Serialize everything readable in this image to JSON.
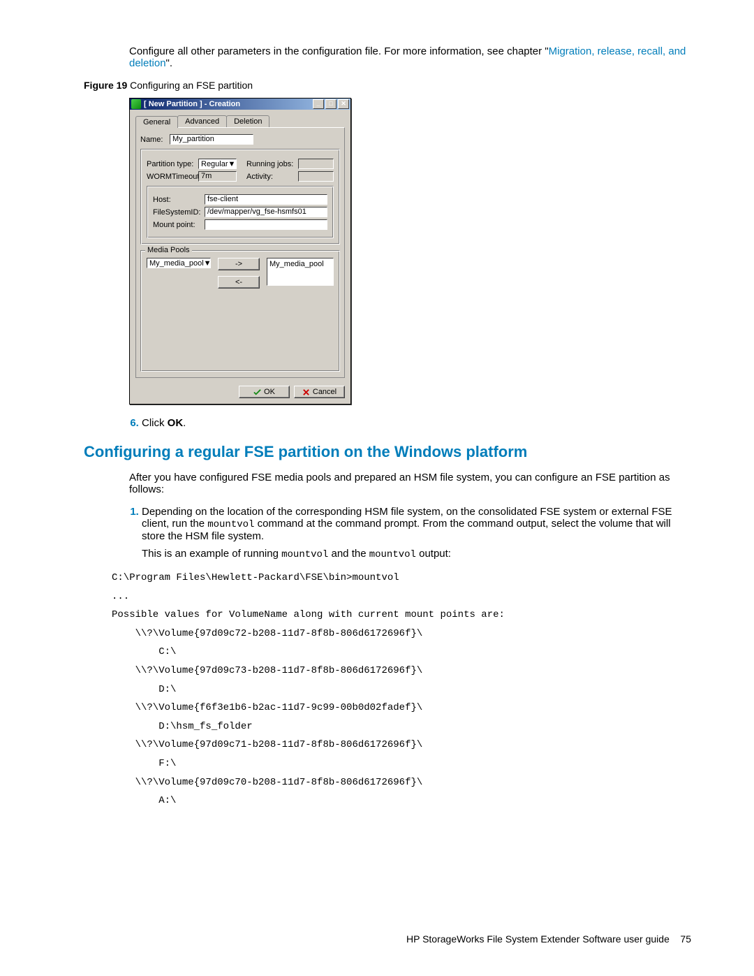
{
  "intro_paragraph": {
    "text_before_link": "Configure all other parameters in the configuration file. For more information, see chapter \"",
    "link_text": "Migration, release, recall, and deletion",
    "text_after_link": "\"."
  },
  "figure": {
    "label": "Figure 19",
    "caption": " Configuring an FSE partition"
  },
  "dialog": {
    "title": "[ New Partition ] - Creation",
    "tabs": {
      "general": "General",
      "advanced": "Advanced",
      "deletion": "Deletion"
    },
    "name_label": "Name:",
    "name_value": "My_partition",
    "partition_type_label": "Partition type:",
    "partition_type_value": "Regular",
    "running_jobs_label": "Running jobs:",
    "running_jobs_value": "",
    "worm_timeout_label": "WORMTimeout:",
    "worm_timeout_value": "7m",
    "activity_label": "Activity:",
    "activity_value": "",
    "host_label": "Host:",
    "host_value": "fse-client",
    "filesystemid_label": "FileSystemID:",
    "filesystemid_value": "/dev/mapper/vg_fse-hsmfs01",
    "mount_point_label": "Mount point:",
    "mount_point_value": "",
    "media_pools_title": "Media Pools",
    "source_pool": "My_media_pool",
    "target_pool": "My_media_pool",
    "add_btn": "->",
    "remove_btn": "<-",
    "ok": "OK",
    "cancel": "Cancel"
  },
  "step6": {
    "num": "6.",
    "text_prefix": "Click ",
    "bold": "OK",
    "text_suffix": "."
  },
  "heading2": "Configuring a regular FSE partition on the Windows platform",
  "after_heading_para": "After you have configured FSE media pools and prepared an HSM file system, you can configure an FSE partition as follows:",
  "step1": {
    "p1_before_code": "Depending on the location of the corresponding HSM file system, on the consolidated FSE system or external FSE client, run the ",
    "p1_code1": "mountvol",
    "p1_mid": " command at the command prompt. From the command output, select the volume that will store the HSM file system.",
    "p2_before": "This is an example of running ",
    "p2_code1": "mountvol",
    "p2_mid": " and the ",
    "p2_code2": "mountvol",
    "p2_after": " output:"
  },
  "code_block": "C:\\Program Files\\Hewlett-Packard\\FSE\\bin>mountvol\n...\nPossible values for VolumeName along with current mount points are:\n    \\\\?\\Volume{97d09c72-b208-11d7-8f8b-806d6172696f}\\\n        C:\\\n    \\\\?\\Volume{97d09c73-b208-11d7-8f8b-806d6172696f}\\\n        D:\\\n    \\\\?\\Volume{f6f3e1b6-b2ac-11d7-9c99-00b0d02fadef}\\\n        D:\\hsm_fs_folder\n    \\\\?\\Volume{97d09c71-b208-11d7-8f8b-806d6172696f}\\\n        F:\\\n    \\\\?\\Volume{97d09c70-b208-11d7-8f8b-806d6172696f}\\\n        A:\\",
  "footer": {
    "text": "HP StorageWorks File System Extender Software user guide",
    "page": "75"
  }
}
